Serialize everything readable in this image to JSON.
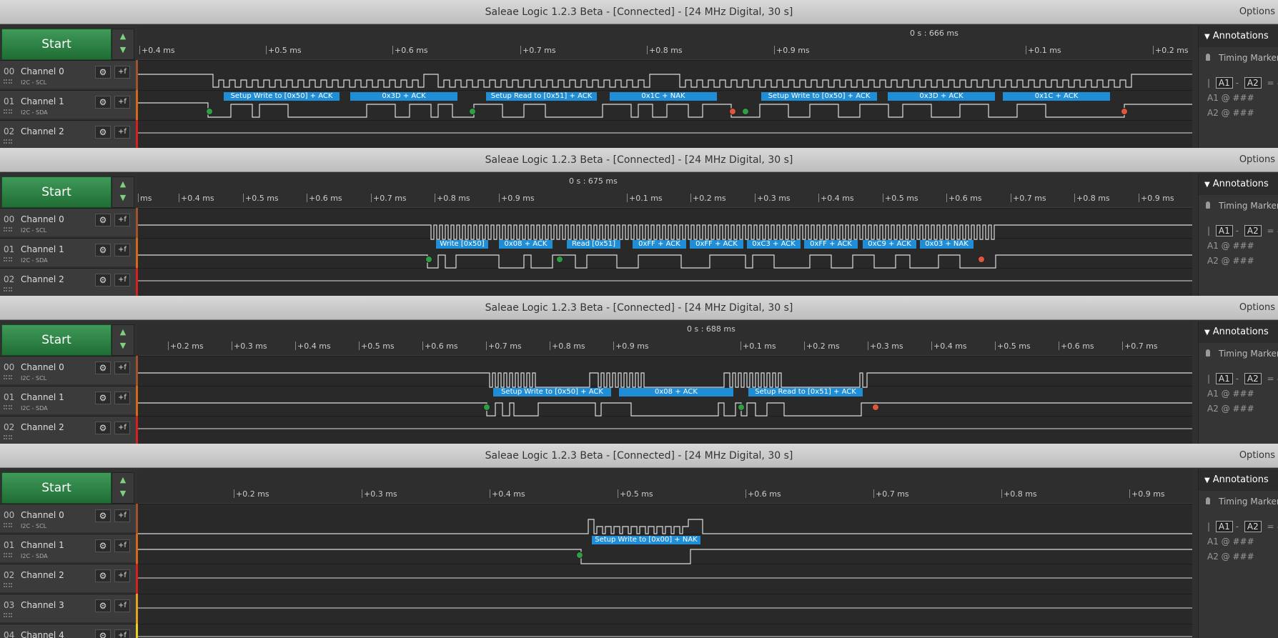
{
  "windows": [
    {
      "title": "Saleae Logic 1.2.3 Beta - [Connected] - [24 MHz Digital, 30 s]",
      "options": "Options",
      "start": "Start",
      "center_time": "0 s : 666 ms",
      "ticks": [
        "+0.4 ms",
        "+0.5 ms",
        "+0.6 ms",
        "+0.7 ms",
        "+0.8 ms",
        "+0.9 ms",
        "+0.1 ms",
        "+0.2 ms"
      ],
      "channels": [
        {
          "num": "00",
          "name": "Channel 0",
          "sub": "I2C - SCL"
        },
        {
          "num": "01",
          "name": "Channel 1",
          "sub": "I2C - SDA"
        },
        {
          "num": "02",
          "name": "Channel 2",
          "sub": ""
        }
      ],
      "annotations": [
        "Setup Write to [0x50] + ACK",
        "0x3D + ACK",
        "Setup Read to [0x51] + ACK",
        "0x1C + NAK",
        "Setup Write to [0x50] + ACK",
        "0x3D + ACK",
        "0x1C + ACK"
      ]
    },
    {
      "title": "Saleae Logic 1.2.3 Beta - [Connected] - [24 MHz Digital, 30 s]",
      "options": "Options",
      "start": "Start",
      "center_time": "0 s : 675 ms",
      "ticks": [
        "ms",
        "+0.4 ms",
        "+0.5 ms",
        "+0.6 ms",
        "+0.7 ms",
        "+0.8 ms",
        "+0.9 ms",
        "+0.1 ms",
        "+0.2 ms",
        "+0.3 ms",
        "+0.4 ms",
        "+0.5 ms",
        "+0.6 ms",
        "+0.7 ms",
        "+0.8 ms",
        "+0.9 ms"
      ],
      "channels": [
        {
          "num": "00",
          "name": "Channel 0",
          "sub": "I2C - SCL"
        },
        {
          "num": "01",
          "name": "Channel 1",
          "sub": "I2C - SDA"
        },
        {
          "num": "02",
          "name": "Channel 2",
          "sub": ""
        }
      ],
      "annotations": [
        "Write [0x50]",
        "0x08 + ACK",
        "Read [0x51]",
        "0xFF + ACK",
        "0xFF + ACK",
        "0xC3 + ACK",
        "0xFF + ACK",
        "0xC9 + ACK",
        "0x03 + NAK"
      ]
    },
    {
      "title": "Saleae Logic 1.2.3 Beta - [Connected] - [24 MHz Digital, 30 s]",
      "options": "Options",
      "start": "Start",
      "center_time": "0 s : 688 ms",
      "ticks": [
        "+0.2 ms",
        "+0.3 ms",
        "+0.4 ms",
        "+0.5 ms",
        "+0.6 ms",
        "+0.7 ms",
        "+0.8 ms",
        "+0.9 ms",
        "+0.1 ms",
        "+0.2 ms",
        "+0.3 ms",
        "+0.4 ms",
        "+0.5 ms",
        "+0.6 ms",
        "+0.7 ms"
      ],
      "channels": [
        {
          "num": "00",
          "name": "Channel 0",
          "sub": "I2C - SCL"
        },
        {
          "num": "01",
          "name": "Channel 1",
          "sub": "I2C - SDA"
        },
        {
          "num": "02",
          "name": "Channel 2",
          "sub": ""
        }
      ],
      "annotations": [
        "Setup Write to [0x50] + ACK",
        "0x08 + ACK",
        "Setup Read to [0x51] + ACK"
      ]
    },
    {
      "title": "Saleae Logic 1.2.3 Beta - [Connected] - [24 MHz Digital, 30 s]",
      "options": "Options",
      "start": "Start",
      "center_time": "",
      "ticks": [
        "+0.2 ms",
        "+0.3 ms",
        "+0.4 ms",
        "+0.5 ms",
        "+0.6 ms",
        "+0.7 ms",
        "+0.8 ms",
        "+0.9 ms"
      ],
      "channels": [
        {
          "num": "00",
          "name": "Channel 0",
          "sub": "I2C - SCL"
        },
        {
          "num": "01",
          "name": "Channel 1",
          "sub": "I2C - SDA"
        },
        {
          "num": "02",
          "name": "Channel 2",
          "sub": ""
        },
        {
          "num": "03",
          "name": "Channel 3",
          "sub": ""
        },
        {
          "num": "04",
          "name": "Channel 4",
          "sub": ""
        }
      ],
      "annotations": [
        "Setup Write to [0x00] + NAK"
      ]
    }
  ],
  "annotations_pane": {
    "header": "Annotations",
    "timing": "Timing Marker Pair",
    "pair_a1": "A1",
    "pair_a2": "A2",
    "pair_eq": "= ###",
    "a1_label": "A1",
    "a2_label": "A2",
    "at": "@",
    "value": "###"
  },
  "colors": {
    "accent": "#1f8ed6",
    "start": "#2e8b46",
    "ch0": "#a0522d",
    "ch1": "#d2691e",
    "ch2": "#d62020",
    "ch3": "#e8a020",
    "ch4": "#e8d020"
  }
}
